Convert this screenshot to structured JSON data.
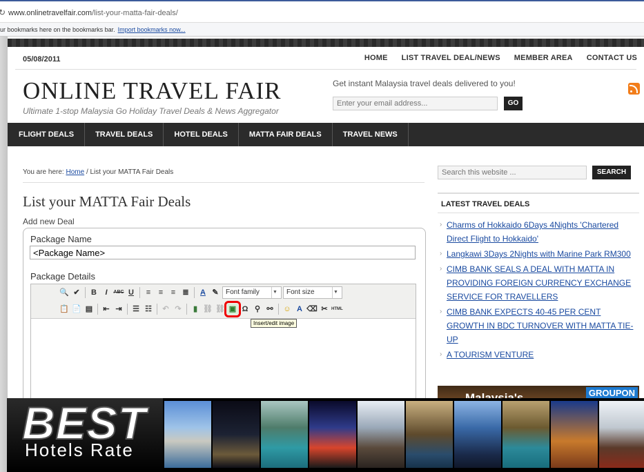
{
  "browser": {
    "url_domain": "www.onlinetravelfair.com",
    "url_path": "/list-your-matta-fair-deals/",
    "bookmarks_text": "ur bookmarks here on the bookmarks bar.",
    "import_link": "Import bookmarks now..."
  },
  "header": {
    "date": "05/08/2011",
    "top_nav": [
      "HOME",
      "LIST TRAVEL DEAL/NEWS",
      "MEMBER AREA",
      "CONTACT US"
    ],
    "logo": "ONLINE TRAVEL FAIR",
    "tagline": "Ultimate 1-stop Malaysia Go Holiday Travel Deals & News Aggregator",
    "subscribe_text": "Get instant Malaysia travel deals delivered to you!",
    "email_placeholder": "Enter your email address...",
    "go_label": "GO"
  },
  "main_nav": [
    "FLIGHT DEALS",
    "TRAVEL DEALS",
    "HOTEL DEALS",
    "MATTA FAIR DEALS",
    "TRAVEL NEWS"
  ],
  "content": {
    "breadcrumb_prefix": "You are here:",
    "breadcrumb_home": "Home",
    "breadcrumb_current": "/ List your MATTA Fair Deals",
    "page_title": "List your MATTA Fair Deals",
    "add_new": "Add new Deal",
    "package_name_label": "Package Name",
    "package_name_value": "<Package Name>",
    "package_details_label": "Package Details"
  },
  "editor": {
    "font_family": "Font family",
    "font_size": "Font size",
    "tooltip": "Insert/edit image"
  },
  "sidebar": {
    "search_placeholder": "Search this website ...",
    "search_button": "SEARCH",
    "latest_title": "LATEST TRAVEL DEALS",
    "deals": [
      "Charms of Hokkaido 6Days 4Nights 'Chartered Direct Flight to Hokkaido'",
      "Langkawi 3Days 2Nights with Marine Park RM300",
      "CIMB BANK SEALS A DEAL WITH MATTA IN PROVIDING FOREIGN CURRENCY EXCHANGE SERVICE FOR TRAVELLERS",
      "CIMB BANK EXPECTS 40-45 PER CENT GROWTH IN BDC TURNOVER WITH MATTA TIE-UP",
      "A TOURISM VENTURE"
    ],
    "ad_text": "Malaysia's",
    "ad_brand": "GROUPON"
  },
  "banner": {
    "best": "BEST",
    "hotels_rate": "Hotels Rate"
  },
  "colors": {
    "nav_bg": "#2b2b2b",
    "link": "#1a4aa0",
    "highlight": "#e00000",
    "rss": "#f27d1a"
  }
}
